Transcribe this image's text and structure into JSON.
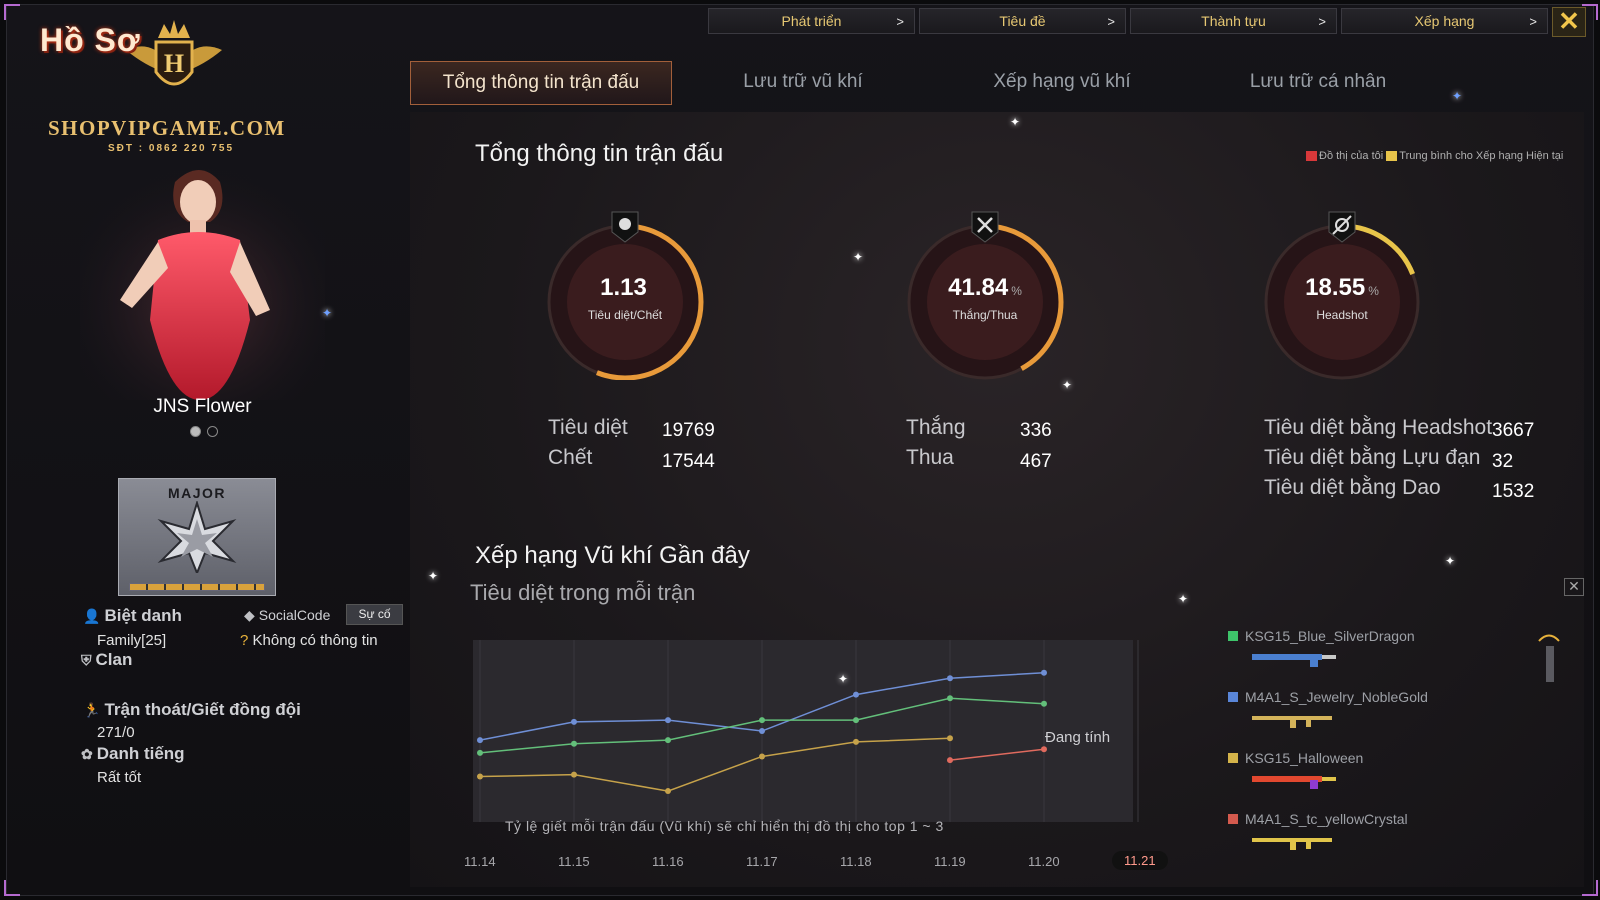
{
  "logo": {
    "title": "Hồ Sơ",
    "badge_letter": "H",
    "site": "SHOPVIPGAME.COM",
    "phone": "SĐT : 0862 220 755"
  },
  "topnav": [
    {
      "label": "Phát triển",
      "chev": ">"
    },
    {
      "label": "Tiêu đề",
      "chev": ">"
    },
    {
      "label": "Thành tựu",
      "chev": ">"
    },
    {
      "label": "Xếp hạng",
      "chev": ">"
    }
  ],
  "close_glyph": "✕",
  "character": {
    "name": "JNS Flower"
  },
  "rank": {
    "label": "MAJOR"
  },
  "profile": {
    "nickname_label": "Biệt danh",
    "nickname_value": "Family[25]",
    "social_label": "SocialCode",
    "social_button": "Sự cố",
    "social_value": "Không có thông tin",
    "clan_label": "Clan",
    "desert_label": "Trận thoát/Giết đồng đội",
    "desert_value": "271/0",
    "reputation_label": "Danh tiếng",
    "reputation_value": "Rất tốt"
  },
  "tabs": [
    {
      "label": "Tổng thông tin trận đấu",
      "active": true
    },
    {
      "label": "Lưu trữ vũ khí",
      "active": false
    },
    {
      "label": "Xếp hạng vũ khí",
      "active": false
    },
    {
      "label": "Lưu trữ cá nhân",
      "active": false
    }
  ],
  "main": {
    "title": "Tổng thông tin trận đấu",
    "legend": [
      {
        "label": "Đồ thị của tôi",
        "color": "#d8383a"
      },
      {
        "label": "Trung bình cho Xếp hạng Hiện tại",
        "color": "#e8c44a"
      }
    ]
  },
  "gauges": [
    {
      "value": "1.13",
      "unit": "",
      "caption": "Tiêu diệt/Chết",
      "fraction": 0.56
    },
    {
      "value": "41.84",
      "unit": "%",
      "caption": "Thắng/Thua",
      "fraction": 0.42
    },
    {
      "value": "18.55",
      "unit": "%",
      "caption": "Headshot",
      "fraction": 0.19
    }
  ],
  "stats": {
    "kills_label": "Tiêu diệt",
    "kills_value": "19769",
    "deaths_label": "Chết",
    "deaths_value": "17544",
    "wins_label": "Thắng",
    "wins_value": "336",
    "losses_label": "Thua",
    "losses_value": "467",
    "hs_label": "Tiêu diệt bằng Headshot",
    "hs_value": "3667",
    "grenade_label": "Tiêu diệt bằng Lựu đạn",
    "grenade_value": "32",
    "knife_label": "Tiêu diệt bằng Dao",
    "knife_value": "1532"
  },
  "weapon_section": {
    "title": "Xếp hạng Vũ khí Gần đây",
    "subtitle": "Tiêu diệt trong mỗi trận",
    "status": "Đang tính",
    "note": "Tỷ lệ giết mỗi trận đấu (Vũ khí) sẽ chỉ hiển thị đồ thị cho top 1 ~ 3",
    "close_glyph": "✕"
  },
  "chart_data": {
    "type": "line",
    "title": "Tiêu diệt trong mỗi trận",
    "x": [
      "11.14",
      "11.15",
      "11.16",
      "11.17",
      "11.18",
      "11.19",
      "11.20",
      "11.21"
    ],
    "current_x": "11.21",
    "ylim": [
      0,
      10
    ],
    "series": [
      {
        "name": "KSG15_Blue_SilverDragon",
        "color": "#6f8fd6",
        "values": [
          4.5,
          5.5,
          5.6,
          5.0,
          7.0,
          7.9,
          8.2,
          null
        ]
      },
      {
        "name": "M4A1_S_Jewelry_NobleGold",
        "color": "#63bf7a",
        "values": [
          3.8,
          4.3,
          4.5,
          5.6,
          5.6,
          6.8,
          6.5,
          null
        ]
      },
      {
        "name": "KSG15_Halloween",
        "color": "#c6a24a",
        "values": [
          2.5,
          2.6,
          1.7,
          3.6,
          4.4,
          4.6,
          null,
          null
        ]
      },
      {
        "name": "M4A1_S_tc_yellowCrystal",
        "color": "#e06a5e",
        "values": [
          null,
          null,
          null,
          null,
          null,
          3.4,
          4.0,
          null
        ]
      }
    ]
  },
  "weapons": [
    {
      "name": "KSG15_Blue_SilverDragon",
      "color": "#3ec46a",
      "gun_color": "#4a7fcf"
    },
    {
      "name": "M4A1_S_Jewelry_NobleGold",
      "color": "#5a86d8",
      "gun_color": "#d4b35a"
    },
    {
      "name": "KSG15_Halloween",
      "color": "#d4b34a",
      "gun_color": "#e2482f"
    },
    {
      "name": "M4A1_S_tc_yellowCrystal",
      "color": "#d45a4e",
      "gun_color": "#e0c44a"
    }
  ]
}
